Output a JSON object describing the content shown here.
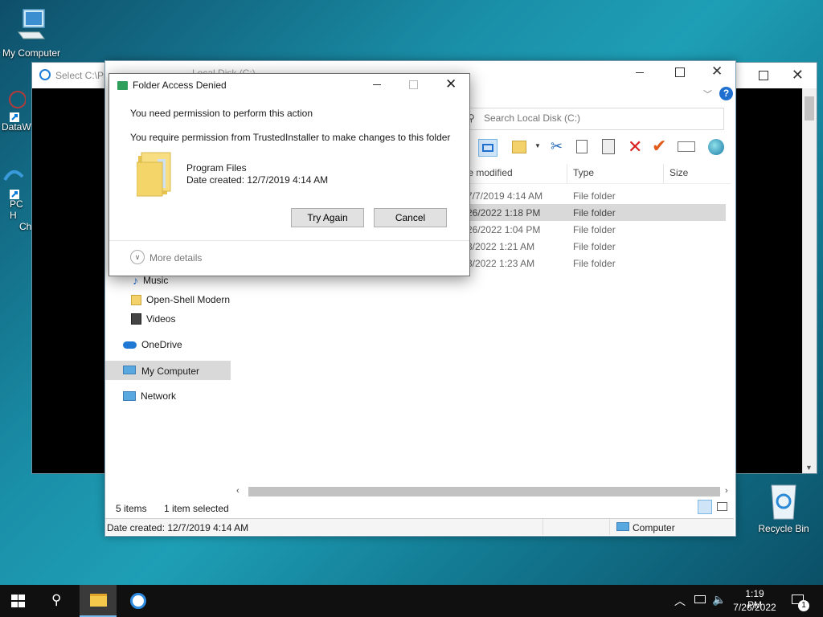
{
  "desktop": {
    "icons": [
      {
        "label": "My Computer"
      },
      {
        "label": "DataW"
      },
      {
        "label": "PC H"
      },
      {
        "label": "Ch"
      },
      {
        "label": "Recycle Bin"
      }
    ]
  },
  "bg_window": {
    "title": "Select C:\\Pr"
  },
  "explorer": {
    "title": "Local Disk (C:)",
    "search_placeholder": "Search Local Disk (C:)",
    "columns": {
      "date": "te modified",
      "type": "Type",
      "size": "Size"
    },
    "rows": [
      {
        "date": "7/7/2019 4:14 AM",
        "type": "File folder"
      },
      {
        "date": "26/2022 1:18 PM",
        "type": "File folder"
      },
      {
        "date": "26/2022 1:04 PM",
        "type": "File folder"
      },
      {
        "date": "3/2022 1:21 AM",
        "type": "File folder"
      },
      {
        "date": "3/2022 1:23 AM",
        "type": "File folder"
      }
    ],
    "nav": [
      {
        "label": "Music"
      },
      {
        "label": "Open-Shell Modern"
      },
      {
        "label": "Videos"
      },
      {
        "label": "OneDrive"
      },
      {
        "label": "My Computer"
      },
      {
        "label": "Network"
      }
    ],
    "status": {
      "items": "5 items",
      "selected": "1 item selected",
      "date_created": "Date created: 12/7/2019 4:14 AM",
      "location": "Computer"
    }
  },
  "dialog": {
    "title": "Folder Access Denied",
    "heading": "You need permission to perform this action",
    "message": "You require permission from TrustedInstaller to make changes to this folder",
    "folder_name": "Program Files",
    "folder_date": "Date created: 12/7/2019 4:14 AM",
    "try_again": "Try Again",
    "cancel": "Cancel",
    "more_details": "More details"
  },
  "taskbar": {
    "time": "1:19 PM",
    "date": "7/26/2022",
    "notification_count": "1"
  },
  "colors": {
    "accent": "#0078d7",
    "selected_row": "#d9d9d9",
    "taskbar": "#101010"
  }
}
